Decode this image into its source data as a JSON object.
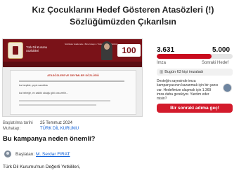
{
  "petition": {
    "title": "Kız Çocuklarını Hedef Gösteren Atasözleri (!) Sözlüğümüzden Çıkarılsın"
  },
  "media": {
    "site_name": "Türk Dil Kurumu Sözlükleri",
    "site_menu": "Sözlükler Hakkında  •  Bize Ulaşın  •  Türkçe Türkçe Sözlük",
    "badge": "100",
    "panel_heading": "ATASÖZLERİ VE DEYİMLER SÖZLÜĞÜ",
    "panel_line_1": "kız beşikte, çeyiz sandıkta",
    "panel_line_2": "kız bebeğe, ev sahibi olduğu gibi ona verilir..."
  },
  "meta": {
    "date_label": "Başlatılma tarihi",
    "date_value": "25 Temmuz 2024",
    "target_label": "Muhatap:",
    "target_value": "TÜRK DİL KURUMU"
  },
  "why": {
    "heading": "Bu kampanya neden önemli?"
  },
  "starter": {
    "label": "Başlatan:",
    "name": "M. Serdar FIRAT"
  },
  "body": {
    "first_line": "Türk Dil Kurumu'nun Değerli Yetkilileri,"
  },
  "stats": {
    "count": "3.631",
    "count_label": "İmza",
    "goal": "5.000",
    "goal_label": "Sonraki Hedef",
    "progress_fraction": 0.7262
  },
  "today": {
    "icon": "chart-icon",
    "text": "Bugün 63 kişi imzaladı"
  },
  "info": {
    "text": "Desteğin sayesinde imza kampanyasının kazanmak için bir şansı var. Hedefimize ulaşmak için 1.369 imza daha gerekiyor. Yardım eder misin?"
  },
  "cta": {
    "label": "Bir sonraki adıma geç!"
  },
  "colors": {
    "brand_red": "#d31b2c",
    "progress_red": "#c90b1e",
    "link_blue": "#0b5ed7"
  }
}
